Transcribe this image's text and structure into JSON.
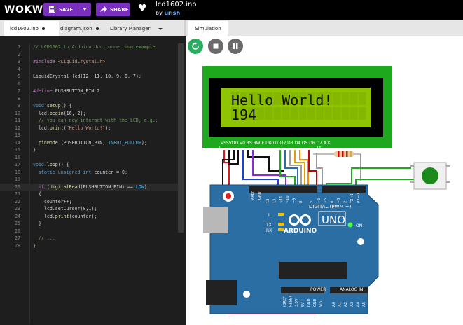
{
  "app": {
    "logo": "WOKWI",
    "project_title": "lcd1602.ino",
    "by_label": "by",
    "author": "urish"
  },
  "toolbar": {
    "save_label": "SAVE",
    "share_label": "SHARE"
  },
  "tabs": [
    {
      "label": "lcd1602.ino",
      "active": true
    },
    {
      "label": "diagram.json",
      "active": false
    },
    {
      "label": "Library Manager",
      "active": false
    }
  ],
  "sim_tab": {
    "label": "Simulation"
  },
  "code": [
    {
      "n": "1",
      "parts": [
        [
          "c-cm",
          "// LCD1602 to Arduino Uno connection example"
        ]
      ]
    },
    {
      "n": "2",
      "parts": []
    },
    {
      "n": "3",
      "parts": [
        [
          "c-pp",
          "#include "
        ],
        [
          "c-st",
          "<LiquidCrystal.h>"
        ]
      ]
    },
    {
      "n": "4",
      "parts": []
    },
    {
      "n": "5",
      "parts": [
        [
          "",
          "LiquidCrystal lcd(12, 11, 10, 9, 8, 7);"
        ]
      ]
    },
    {
      "n": "6",
      "parts": []
    },
    {
      "n": "7",
      "parts": [
        [
          "c-pp",
          "#define "
        ],
        [
          "",
          "PUSHBUTTON_PIN 2"
        ]
      ]
    },
    {
      "n": "8",
      "parts": []
    },
    {
      "n": "9",
      "parts": [
        [
          "c-ty",
          "void "
        ],
        [
          "c-fn",
          "setup"
        ],
        [
          "",
          "() {"
        ]
      ]
    },
    {
      "n": "10",
      "parts": [
        [
          "",
          "  lcd."
        ],
        [
          "c-fn",
          "begin"
        ],
        [
          "",
          "(16, 2);"
        ]
      ]
    },
    {
      "n": "11",
      "parts": [
        [
          "c-cm",
          "  // you can now interact with the LCD, e.g.:"
        ]
      ]
    },
    {
      "n": "12",
      "parts": [
        [
          "",
          "  lcd."
        ],
        [
          "c-fn",
          "print"
        ],
        [
          "",
          "("
        ],
        [
          "c-st",
          "\"Hello World!\""
        ],
        [
          "",
          ");"
        ]
      ]
    },
    {
      "n": "13",
      "parts": []
    },
    {
      "n": "14",
      "parts": [
        [
          "c-fn",
          "  pinMode "
        ],
        [
          "",
          "(PUSHBUTTON_PIN, "
        ],
        [
          "c-cn",
          "INPUT_PULLUP"
        ],
        [
          "",
          ");"
        ]
      ]
    },
    {
      "n": "15",
      "parts": [
        [
          "",
          "}"
        ]
      ]
    },
    {
      "n": "16",
      "parts": []
    },
    {
      "n": "17",
      "parts": [
        [
          "c-ty",
          "void "
        ],
        [
          "c-fn",
          "loop"
        ],
        [
          "",
          "() {"
        ]
      ]
    },
    {
      "n": "18",
      "parts": [
        [
          "c-ty",
          "  static unsigned int "
        ],
        [
          "",
          "counter = 0;"
        ]
      ]
    },
    {
      "n": "19",
      "parts": []
    },
    {
      "n": "20",
      "parts": [
        [
          "c-kw",
          "  if "
        ],
        [
          "",
          "("
        ],
        [
          "c-fn",
          "digitalRead"
        ],
        [
          "",
          "(PUSHBUTTON_PIN) == "
        ],
        [
          "c-cn",
          "LOW"
        ],
        [
          "",
          ")"
        ]
      ]
    },
    {
      "n": "21",
      "parts": [
        [
          "",
          "  {"
        ]
      ]
    },
    {
      "n": "22",
      "parts": [
        [
          "",
          "    counter++;"
        ]
      ]
    },
    {
      "n": "23",
      "parts": [
        [
          "",
          "    lcd.setCursor(0,1);"
        ]
      ]
    },
    {
      "n": "24",
      "parts": [
        [
          "",
          "    lcd."
        ],
        [
          "c-fn",
          "print"
        ],
        [
          "",
          "(counter);"
        ]
      ]
    },
    {
      "n": "25",
      "parts": [
        [
          "",
          "  }"
        ]
      ]
    },
    {
      "n": "26",
      "parts": []
    },
    {
      "n": "27",
      "parts": [
        [
          "c-cm",
          "  // ..."
        ]
      ]
    },
    {
      "n": "28",
      "parts": [
        [
          "",
          "}"
        ]
      ]
    }
  ],
  "lcd": {
    "line1": "Hello World!",
    "line2": "194",
    "pin_labels": "VSSVDD V0 RS RW E D0 D1 D2 D3 D4 D5 D6 D7 A K",
    "pin_first": "1",
    "pin_last": "16"
  },
  "arduino": {
    "brand": "ARDUINO",
    "model": "UNO",
    "on_label": "ON",
    "digital_label": "DIGITAL (PWM ~)",
    "aref": "AREF",
    "gnd": "GND",
    "tx": "TX",
    "rx": "RX",
    "l": "L",
    "power_label": "POWER",
    "analog_label": "ANALOG IN",
    "digital_pins": [
      "13",
      "12",
      "~11",
      "~10",
      "~9",
      "8",
      "7",
      "~6",
      "~5",
      "4",
      "~3",
      "2",
      "TX→1",
      "RX←0"
    ],
    "power_pins": [
      "IOREF",
      "RESET",
      "3.3V",
      "5V",
      "GND",
      "GND",
      "Vin"
    ],
    "analog_pins": [
      "A0",
      "A1",
      "A2",
      "A3",
      "A4",
      "A5"
    ]
  },
  "colors": {
    "accent": "#7b2fbf",
    "play": "#27ae60",
    "lcd_board": "#1ea81e",
    "lcd_screen": "#8fc400",
    "arduino_board": "#2b6ea3"
  }
}
